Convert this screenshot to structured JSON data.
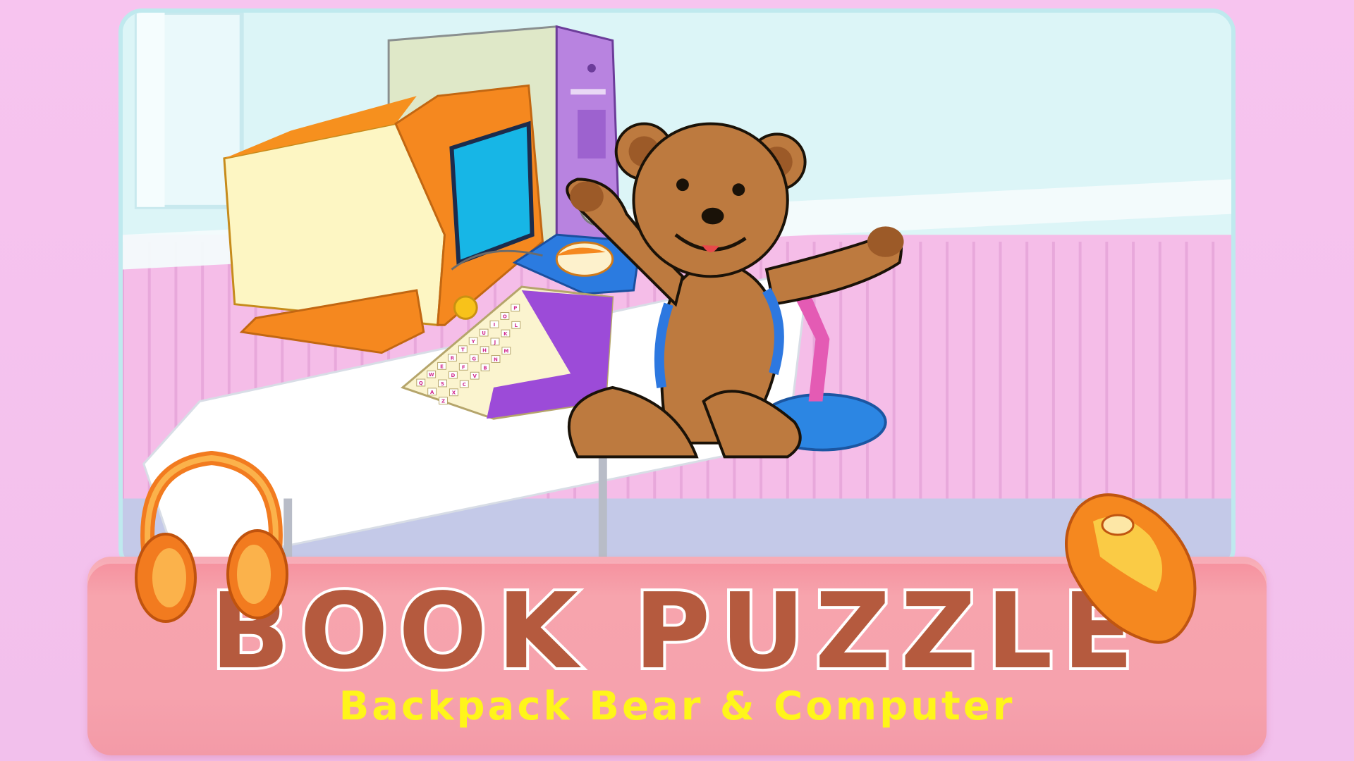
{
  "title": "BOOK PUZZLE",
  "subtitle": "Backpack Bear & Computer",
  "keyboard_rows": [
    [
      "Q",
      "W",
      "E",
      "R",
      "T",
      "Y",
      "U",
      "I",
      "O",
      "P"
    ],
    [
      "A",
      "S",
      "D",
      "F",
      "G",
      "H",
      "J",
      "K",
      "L"
    ],
    [
      "Z",
      "X",
      "C",
      "V",
      "B",
      "N",
      "M"
    ]
  ],
  "colors": {
    "background": "#f7c4ef",
    "banner": "#f6a2ad",
    "title": "#b55a3e",
    "subtitle": "#fff51a",
    "bear": "#c07a3f",
    "monitor": "#f5881f",
    "tower": "#a566d6"
  },
  "icons": [
    "headphones-icon",
    "computer-mouse-icon"
  ]
}
